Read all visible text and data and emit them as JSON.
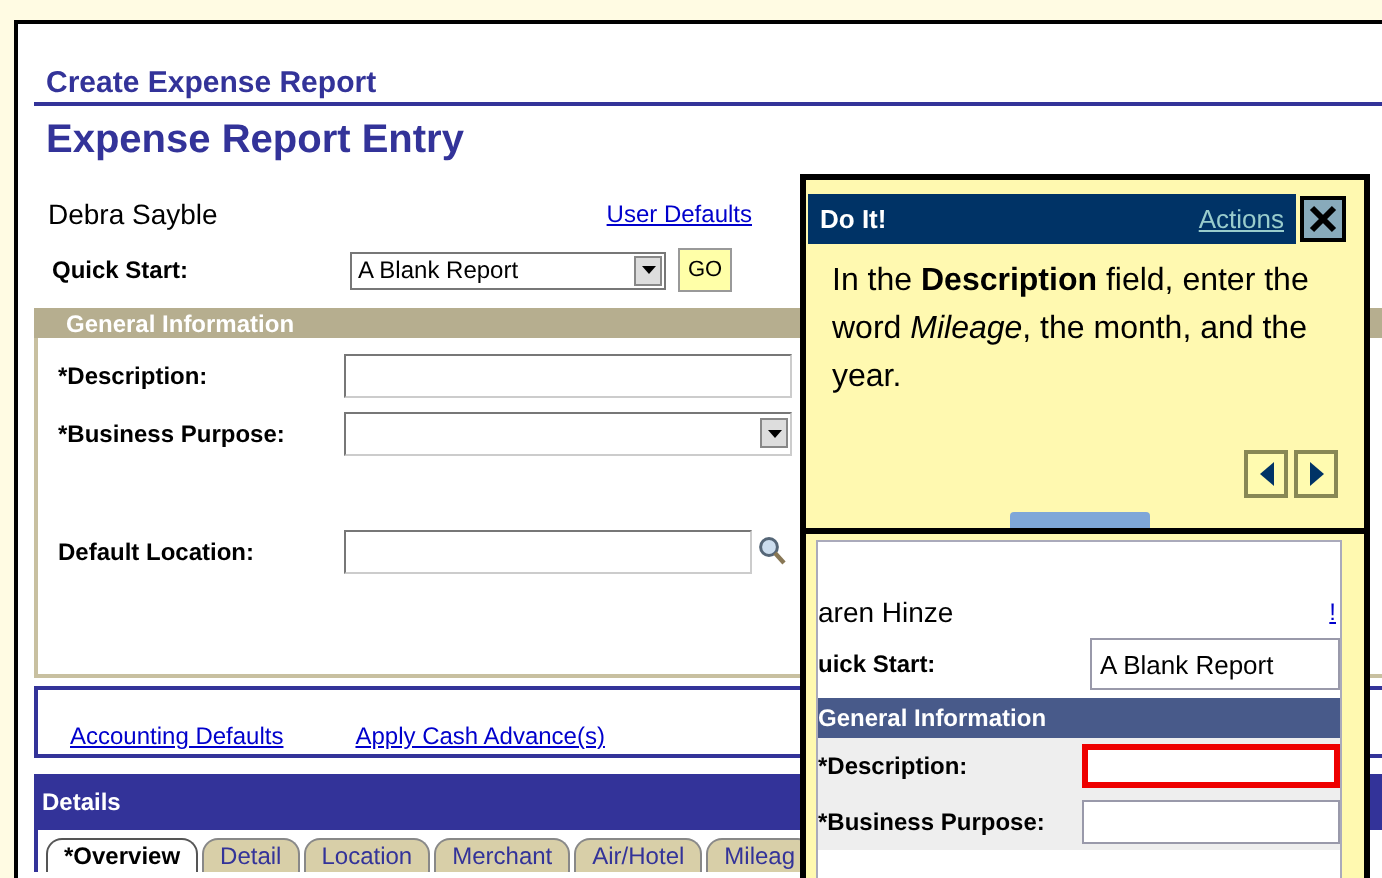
{
  "page": {
    "breadcrumb": "Create Expense Report",
    "title": "Expense Report Entry",
    "employee_name": "Debra Sayble",
    "user_defaults_link": "User Defaults",
    "quick_start": {
      "label": "Quick Start:",
      "value": "A Blank Report",
      "go_button": "GO"
    }
  },
  "general_information": {
    "title": "General Information",
    "expanded": true,
    "fields": [
      {
        "label": "*Description:",
        "kind": "text"
      },
      {
        "label": "*Business Purpose:",
        "kind": "dropdown"
      },
      {
        "label": "Default Location:",
        "kind": "lookup"
      }
    ]
  },
  "links": [
    "Accounting Defaults",
    "Apply Cash Advance(s)"
  ],
  "details": {
    "title": "Details",
    "tabs": [
      {
        "label": "*Overview",
        "selected": true
      },
      {
        "label": "Detail",
        "selected": false
      },
      {
        "label": "Location",
        "selected": false
      },
      {
        "label": "Merchant",
        "selected": false
      },
      {
        "label": "Air/Hotel",
        "selected": false
      },
      {
        "label": "Mileag",
        "selected": false
      }
    ]
  },
  "do_it": {
    "title": "Do It!",
    "actions_link": "Actions",
    "instruction": "In the **Description** field, enter the word *Mileage*, the month, and the year.",
    "preview": {
      "employee_name": "aren Hinze",
      "link_fragment": "!",
      "quick_start_label": "uick Start:",
      "quick_start_value": "A Blank Report",
      "section_title": "General Information",
      "fields": [
        {
          "label": "*Description:",
          "highlighted": true
        },
        {
          "label": "*Business Purpose:",
          "highlighted": false
        }
      ]
    }
  }
}
